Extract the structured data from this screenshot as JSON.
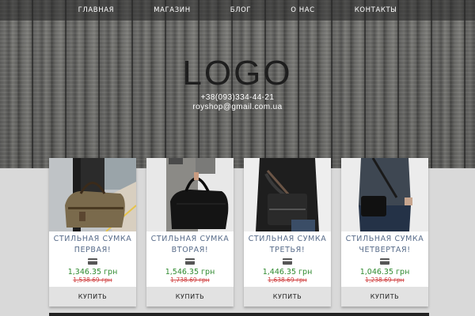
{
  "nav": {
    "items": [
      "ГЛАВНАЯ",
      "МАГАЗИН",
      "БЛОГ",
      "О НАС",
      "КОНТАКТЫ"
    ]
  },
  "header": {
    "logo": "LOGO",
    "phone": "+38(093)334-44-21",
    "email": "royshop@gmail.com.ua"
  },
  "colors": {
    "title": "#586c8a",
    "price": "#2f8a2f",
    "old_price": "#d04040",
    "button_bg": "#e2e2e2"
  },
  "products": [
    {
      "title_line1": "СТИЛЬНАЯ СУМКА",
      "title_line2": "ПЕРВАЯ!",
      "price": "1,346.35 грн",
      "old_price": "1,538.69 грн",
      "buy": "КУПИТЬ",
      "image": "brown canvas duffel bag"
    },
    {
      "title_line1": "СТИЛЬНАЯ СУМКА",
      "title_line2": "ВТОРАЯ!",
      "price": "1,546.35 грн",
      "old_price": "1,738.69 грн",
      "buy": "КУПИТЬ",
      "image": "black leather duffel bag"
    },
    {
      "title_line1": "СТИЛЬНАЯ СУМКА",
      "title_line2": "ТРЕТЬЯ!",
      "price": "1,446.35 грн",
      "old_price": "1,638.69 грн",
      "buy": "КУПИТЬ",
      "image": "black shoulder bag"
    },
    {
      "title_line1": "СТИЛЬНАЯ СУМКА",
      "title_line2": "ЧЕТВЕРТАЯ!",
      "price": "1,046.35 грн",
      "old_price": "1,238.69 грн",
      "buy": "КУПИТЬ",
      "image": "black messenger bag"
    }
  ]
}
